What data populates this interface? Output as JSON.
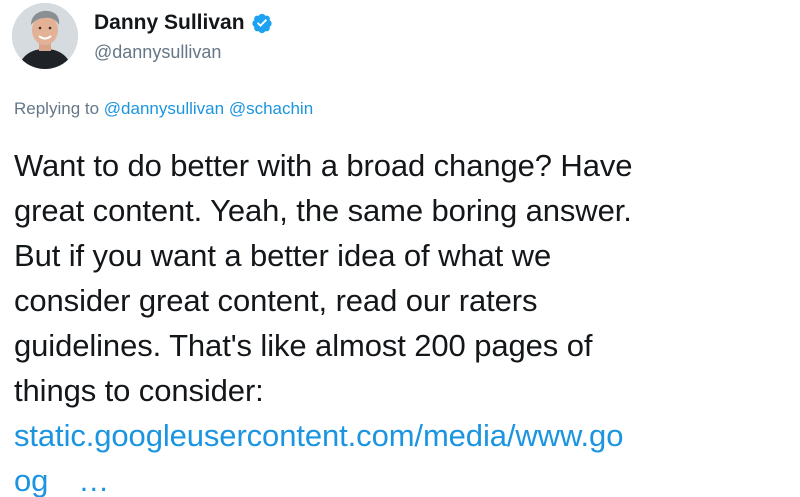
{
  "author": {
    "display_name": "Danny Sullivan",
    "handle": "@dannysullivan",
    "verified": true,
    "avatar_icon": "profile-photo"
  },
  "reply": {
    "prefix": "Replying to",
    "mentions": [
      "@dannysullivan",
      "@schachin"
    ]
  },
  "tweet": {
    "lines": [
      "Want to do better with a broad change? Have",
      "great content. Yeah, the same boring answer.",
      "But if you want a better idea of what we",
      "consider great content, read our raters",
      "guidelines. That's like almost 200 pages of",
      "things to consider:"
    ],
    "link_line1": "static.googleusercontent.com/media/www.go",
    "link_line2_start": "og",
    "link_ellipsis": "…"
  },
  "colors": {
    "link": "#1b95e0",
    "secondary_text": "#657786",
    "verified_badge": "#1da1f2",
    "text": "#14171a"
  }
}
